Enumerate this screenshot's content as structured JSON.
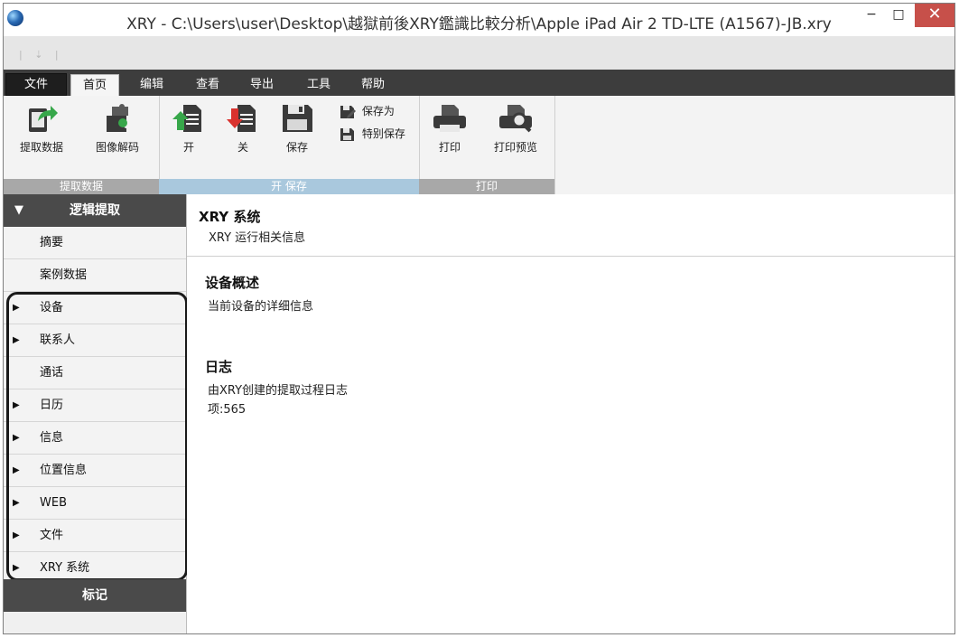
{
  "window": {
    "title": "XRY - C:\\Users\\user\\Desktop\\越獄前後XRY鑑識比較分析\\Apple iPad Air 2 TD-LTE (A1567)-JB.xry",
    "minimize": "−",
    "maximize": "□",
    "close": "✕"
  },
  "qat": {
    "glyph": "| ⇣ |"
  },
  "tabs": [
    "文件",
    "首页",
    "编辑",
    "查看",
    "导出",
    "工具",
    "帮助"
  ],
  "ribbon": {
    "groups": [
      {
        "label": "提取数据",
        "buttons": [
          "提取数据",
          "图像解码"
        ]
      },
      {
        "label": "开 保存",
        "buttons": [
          "开",
          "关",
          "保存"
        ],
        "small": [
          "保存为",
          "特别保存"
        ]
      },
      {
        "label": "打印",
        "buttons": [
          "打印",
          "打印预览"
        ]
      }
    ],
    "colors": {
      "green": "#37a74a",
      "red": "#d9322e",
      "dark": "#3a3a3a"
    }
  },
  "sidebar": {
    "header": "逻辑提取",
    "header_arrow": "▼",
    "items": [
      {
        "label": "摘要",
        "expandable": false
      },
      {
        "label": "案例数据",
        "expandable": false
      },
      {
        "label": "设备",
        "expandable": true
      },
      {
        "label": "联系人",
        "expandable": true
      },
      {
        "label": "通话",
        "expandable": false
      },
      {
        "label": "日历",
        "expandable": true
      },
      {
        "label": "信息",
        "expandable": true
      },
      {
        "label": "位置信息",
        "expandable": true
      },
      {
        "label": "WEB",
        "expandable": true
      },
      {
        "label": "文件",
        "expandable": true
      },
      {
        "label": "XRY 系统",
        "expandable": true
      }
    ],
    "expand_arrow": "▶",
    "bookmark": "标记"
  },
  "main": {
    "header": {
      "title": "XRY 系统",
      "subtitle": "XRY 运行相关信息"
    },
    "sections": [
      {
        "title": "设备概述",
        "lines": [
          "当前设备的详细信息"
        ]
      },
      {
        "title": "日志",
        "lines": [
          "由XRY创建的提取过程日志",
          "项:565"
        ]
      }
    ]
  }
}
